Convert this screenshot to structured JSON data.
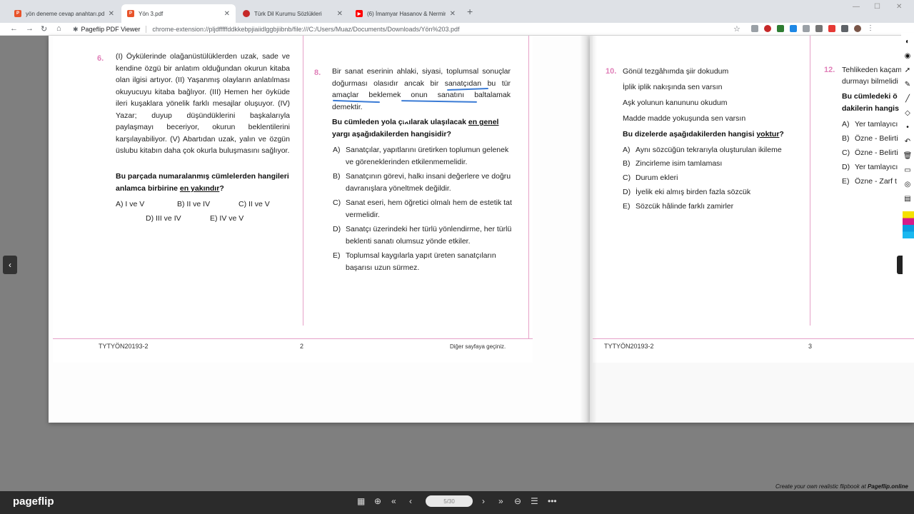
{
  "browser": {
    "tabs": [
      {
        "label": "yön deneme cevap anahtarı.pdf",
        "active": false,
        "icon_color": "#e8532a",
        "icon": "pdf-icon"
      },
      {
        "label": "Yön 3.pdf",
        "active": true,
        "icon_color": "#e8532a",
        "icon": "pdf-icon"
      },
      {
        "label": "Türk Dil Kurumu Sözlükleri",
        "active": false,
        "icon_color": "#c62828",
        "icon": "tdk-icon"
      },
      {
        "label": "(6) İmamyar Hasanov & Nermine",
        "active": false,
        "icon_color": "#ff0000",
        "icon": "youtube-icon"
      }
    ],
    "new_tab": "+",
    "site_name": "Pageflip PDF Viewer",
    "url": "chrome-extension://pljdfffffddkkebpjiaiidlggbjiibnb/file:///C:/Users/Muaz/Documents/Downloads/Yön%203.pdf"
  },
  "page_left": {
    "q6": {
      "number": "6.",
      "text": "(I) Öykülerinde olağanüstülüklerden uzak, sade ve kendine özgü bir anlatım olduğundan okurun kitaba olan ilgisi artıyor. (II) Yaşanmış olayların anlatılması okuyucuyu kitaba bağlıyor. (III) Hemen her öyküde ileri kuşaklara yönelik farklı mesajlar oluşuyor. (IV) Yazar; duyup düşündüklerini başkalarıyla paylaşmayı beceriyor, okurun beklentilerini karşılayabiliyor. (V) Abartıdan uzak, yalın ve özgün üslubu kitabın daha çok okurla buluşmasını sağlıyor.",
      "question": "Bu parçada numaralanmış cümlelerden hangileri anlamca birbirine",
      "question_emph": "en yakındır",
      "question_end": "?",
      "options": [
        {
          "letter": "A)",
          "text": "I ve V"
        },
        {
          "letter": "B)",
          "text": "II ve IV"
        },
        {
          "letter": "C)",
          "text": "II ve V"
        },
        {
          "letter": "D)",
          "text": "III ve IV"
        },
        {
          "letter": "E)",
          "text": "IV ve V"
        }
      ]
    },
    "q8": {
      "number": "8.",
      "text": "Bir sanat eserinin ahlaki, siyasi, toplumsal sonuçlar doğurması olasıdır ancak bir sanatçıdan bu tür amaçlar beklemek onun sanatını baltalamak demektir.",
      "question_start": "Bu cümleden yola çıkılarak ulaşılacak",
      "question_emph": "en genel",
      "question_end": "yargı aşağıdakilerden hangisidir?",
      "options": [
        {
          "letter": "A)",
          "text": "Sanatçılar, yapıtlarını üretirken toplumun gelenek ve göreneklerinden etkilenmemelidir."
        },
        {
          "letter": "B)",
          "text": "Sanatçının görevi, halkı insani değerlere ve doğru davranışlara yöneltmek değildir."
        },
        {
          "letter": "C)",
          "text": "Sanat eseri, hem öğretici olmalı hem de estetik tat vermelidir."
        },
        {
          "letter": "D)",
          "text": "Sanatçı üzerindeki her türlü yönlendirme, her türlü beklenti sanatı olumsuz yönde etkiler."
        },
        {
          "letter": "E)",
          "text": "Toplumsal kaygılarla yapıt üreten sanatçıların başarısı uzun sürmez."
        }
      ]
    },
    "footer_code": "TYTYÖN20193-2",
    "page_number": "2",
    "footer_next": "Diğer sayfaya geçiniz."
  },
  "page_right": {
    "q10": {
      "number": "10.",
      "lines": [
        "Gönül tezgâhımda şiir dokudum",
        "İplik iplik nakışında sen varsın",
        "Aşk yolunun kanununu okudum",
        "Madde madde yokuşunda sen varsın"
      ],
      "question": "Bu dizelerde aşağıdakilerden hangisi",
      "question_emph": "yoktur",
      "question_end": "?",
      "options": [
        {
          "letter": "A)",
          "text": "Aynı sözcüğün tekrarıyla oluşturulan ikileme"
        },
        {
          "letter": "B)",
          "text": "Zincirleme isim tamlaması"
        },
        {
          "letter": "C)",
          "text": "Durum ekleri"
        },
        {
          "letter": "D)",
          "text": "İyelik eki almış birden fazla sözcük"
        },
        {
          "letter": "E)",
          "text": "Sözcük hâlinde farklı zamirler"
        }
      ]
    },
    "q12": {
      "number": "12.",
      "line1": "Tehlikeden kaçam",
      "line2": "durmayı bilmelidi",
      "q_line1": "Bu cümledeki ö",
      "q_line2": "dakilerin hangis",
      "options": [
        {
          "letter": "A)",
          "text": "Yer tamlayıcı"
        },
        {
          "letter": "B)",
          "text": "Özne - Belirti"
        },
        {
          "letter": "C)",
          "text": "Özne - Belirti"
        },
        {
          "letter": "D)",
          "text": "Yer tamlayıcı"
        },
        {
          "letter": "E)",
          "text": "Özne - Zarf t"
        }
      ]
    },
    "footer_code": "TYTYÖN20193-2",
    "page_number": "3"
  },
  "viewer": {
    "credit_prefix": "Create your own realistic flipbook at ",
    "credit_site": "Pageflip.online",
    "logo": "pageflip",
    "page_indicator": "5/30"
  },
  "colors": {
    "accent_pink": "#e07fb8",
    "ink_blue": "#3a7bd5"
  }
}
